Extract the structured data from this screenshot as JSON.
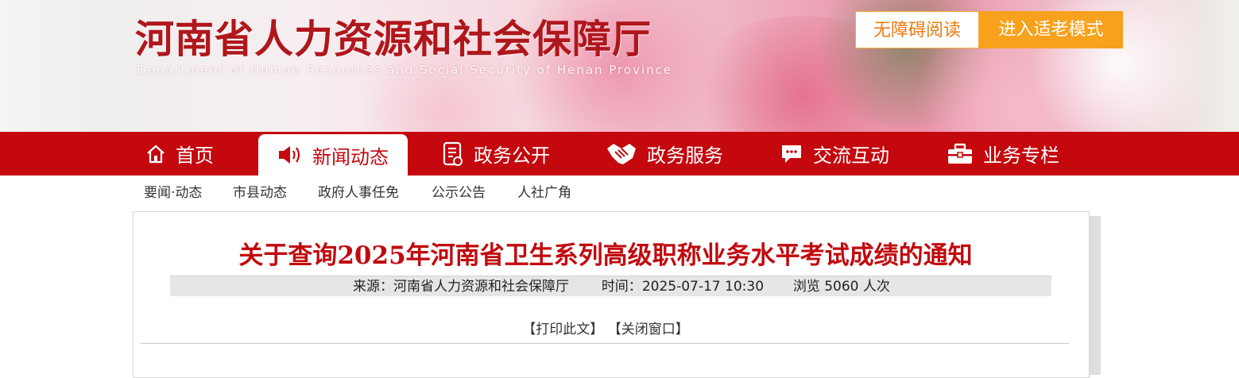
{
  "header": {
    "site_title": "河南省人力资源和社会保障厅",
    "site_subtitle": "Department of Human Resources and Social Security of Henan Province",
    "accessibility_button": "无障碍阅读",
    "elder_mode_button": "进入适老模式"
  },
  "nav": {
    "items": [
      {
        "label": "首页",
        "icon": "home-icon"
      },
      {
        "label": "新闻动态",
        "icon": "speaker-icon",
        "active": true
      },
      {
        "label": "政务公开",
        "icon": "document-icon"
      },
      {
        "label": "政务服务",
        "icon": "handshake-icon"
      },
      {
        "label": "交流互动",
        "icon": "chat-icon"
      },
      {
        "label": "业务专栏",
        "icon": "briefcase-icon"
      }
    ]
  },
  "subnav": {
    "items": [
      "要闻·动态",
      "市县动态",
      "政府人事任免",
      "公示公告",
      "人社广角"
    ]
  },
  "article": {
    "title": "关于查询2025年河南省卫生系列高级职称业务水平考试成绩的通知",
    "source_label": "来源：",
    "source": "河南省人力资源和社会保障厅",
    "time_label": "时间：",
    "time": "2025-07-17 10:30",
    "views_prefix": "浏览",
    "views": "5060",
    "views_suffix": "人次",
    "print_label": "【打印此文】",
    "close_label": "【关闭窗口】"
  },
  "colors": {
    "brand_red": "#c4080e",
    "title_red": "#b0171c",
    "orange": "#f7a11c"
  }
}
